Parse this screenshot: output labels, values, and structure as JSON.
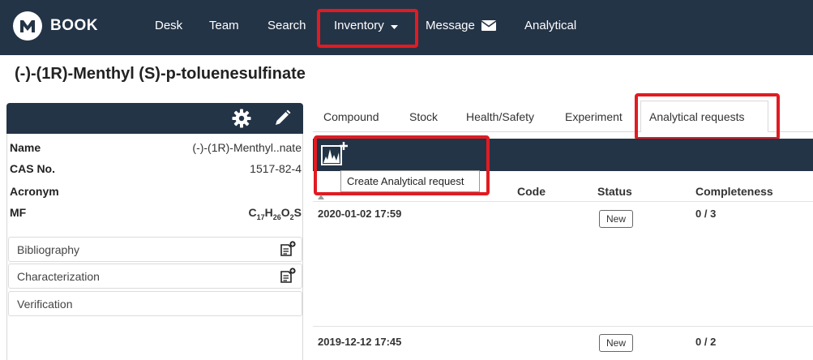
{
  "navbar": {
    "brand": "BOOK",
    "items": [
      "Desk",
      "Team",
      "Search",
      "Inventory",
      "Message",
      "Analytical"
    ]
  },
  "page": {
    "title": "(-)-(1R)-Menthyl (S)-p-toluenesulfinate"
  },
  "compound": {
    "properties": [
      {
        "label": "Name",
        "value": "(-)-(1R)-Menthyl..nate"
      },
      {
        "label": "CAS No.",
        "value": "1517-82-4"
      },
      {
        "label": "Acronym",
        "value": ""
      },
      {
        "label": "MF",
        "value": "C17H26O2S"
      }
    ],
    "sections": [
      "Bibliography",
      "Characterization",
      "Verification"
    ]
  },
  "tabs": {
    "items": [
      "Compound",
      "Stock",
      "Health/Safety",
      "Experiment"
    ],
    "active": "Analytical requests"
  },
  "toolbar": {
    "tooltip": "Create Analytical request"
  },
  "table": {
    "headers": [
      "Code",
      "Status",
      "Completeness"
    ],
    "rows": [
      {
        "date": "2020-01-02 17:59",
        "code": "",
        "status": "New",
        "completeness": "0 / 3"
      },
      {
        "date": "2019-12-12 17:45",
        "code": "",
        "status": "New",
        "completeness": "0 / 2"
      }
    ]
  },
  "colors": {
    "navbar": "#243447",
    "highlight": "#e11b22"
  }
}
